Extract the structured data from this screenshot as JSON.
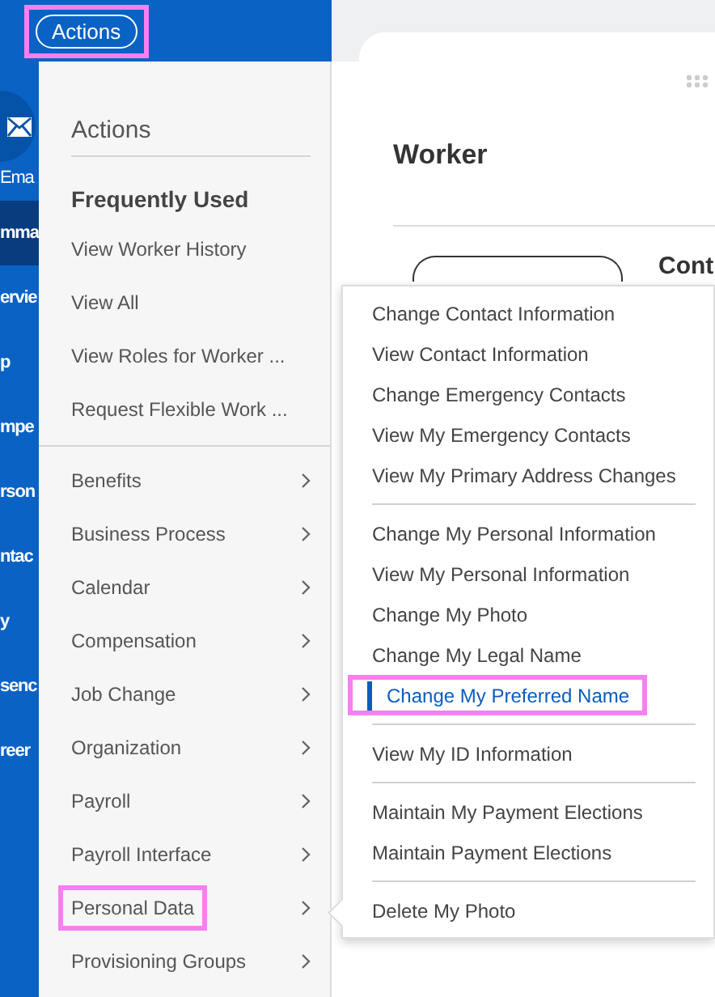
{
  "top_bar": {
    "actions_button": {
      "label": "Actions",
      "highlighted": true
    }
  },
  "sidebar": {
    "items": [
      {
        "label": "Ema",
        "kind": "icon"
      },
      {
        "label": "mma",
        "kind": "text",
        "selected": true
      },
      {
        "label": "ervie",
        "kind": "text",
        "selected": false
      },
      {
        "label": "p",
        "kind": "text",
        "selected": false
      },
      {
        "label": "mpe",
        "kind": "text",
        "selected": false
      },
      {
        "label": "rson",
        "kind": "text",
        "selected": false
      },
      {
        "label": "ntac",
        "kind": "text",
        "selected": false
      },
      {
        "label": "y",
        "kind": "text",
        "selected": false
      },
      {
        "label": "senc",
        "kind": "text",
        "selected": false
      },
      {
        "label": "reer",
        "kind": "text",
        "selected": false
      }
    ]
  },
  "actions_menu": {
    "title": "Actions",
    "frequently_used": {
      "heading": "Frequently Used",
      "items": [
        "View Worker History",
        "View All",
        "View Roles for Worker ...",
        "Request Flexible Work ..."
      ]
    },
    "categories": [
      {
        "label": "Benefits",
        "selected": false
      },
      {
        "label": "Business Process",
        "selected": false
      },
      {
        "label": "Calendar",
        "selected": false
      },
      {
        "label": "Compensation",
        "selected": false
      },
      {
        "label": "Job Change",
        "selected": false
      },
      {
        "label": "Organization",
        "selected": false
      },
      {
        "label": "Payroll",
        "selected": false
      },
      {
        "label": "Payroll Interface",
        "selected": false
      },
      {
        "label": "Personal Data",
        "selected": true
      },
      {
        "label": "Provisioning Groups",
        "selected": false
      }
    ]
  },
  "worker_panel": {
    "title": "Worker",
    "column_2_heading": "Cont"
  },
  "submenu": {
    "groups": [
      [
        {
          "label": "Change Contact Information",
          "selected": false
        },
        {
          "label": "View Contact Information",
          "selected": false
        },
        {
          "label": "Change Emergency Contacts",
          "selected": false
        },
        {
          "label": "View My Emergency Contacts",
          "selected": false
        },
        {
          "label": "View My Primary Address Changes",
          "selected": false
        }
      ],
      [
        {
          "label": "Change My Personal Information",
          "selected": false
        },
        {
          "label": "View My Personal Information",
          "selected": false
        },
        {
          "label": "Change My Photo",
          "selected": false
        },
        {
          "label": "Change My Legal Name",
          "selected": false
        },
        {
          "label": "Change My Preferred Name",
          "selected": true
        }
      ],
      [
        {
          "label": "View My ID Information",
          "selected": false
        }
      ],
      [
        {
          "label": "Maintain My Payment Elections",
          "selected": false
        },
        {
          "label": "Maintain Payment Elections",
          "selected": false
        }
      ],
      [
        {
          "label": "Delete My Photo",
          "selected": false
        }
      ]
    ]
  }
}
